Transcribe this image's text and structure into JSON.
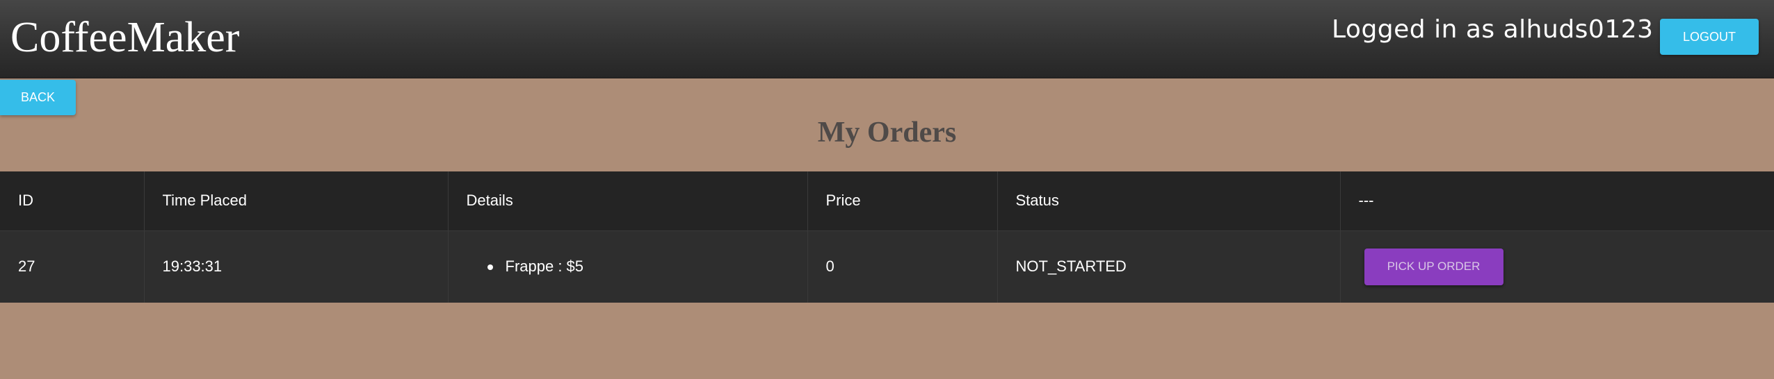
{
  "app": {
    "brand": "CoffeeMaker"
  },
  "header": {
    "login_text": "Logged in as alhuds0123",
    "logout_label": "LOGOUT"
  },
  "nav": {
    "back_label": "BACK"
  },
  "page": {
    "title": "My Orders"
  },
  "table": {
    "columns": [
      "ID",
      "Time Placed",
      "Details",
      "Price",
      "Status",
      "---"
    ],
    "rows": [
      {
        "id": "27",
        "time_placed": "19:33:31",
        "details": [
          "Frappe : $5"
        ],
        "price": "0",
        "status": "NOT_STARTED",
        "action_label": "PICK UP ORDER"
      }
    ]
  },
  "colors": {
    "background": "#ad8d77",
    "navbar": "#333333",
    "accent": "#35bde9",
    "action": "#8a3dbf",
    "table_header": "#242424",
    "table_row": "#2e2e2e"
  }
}
